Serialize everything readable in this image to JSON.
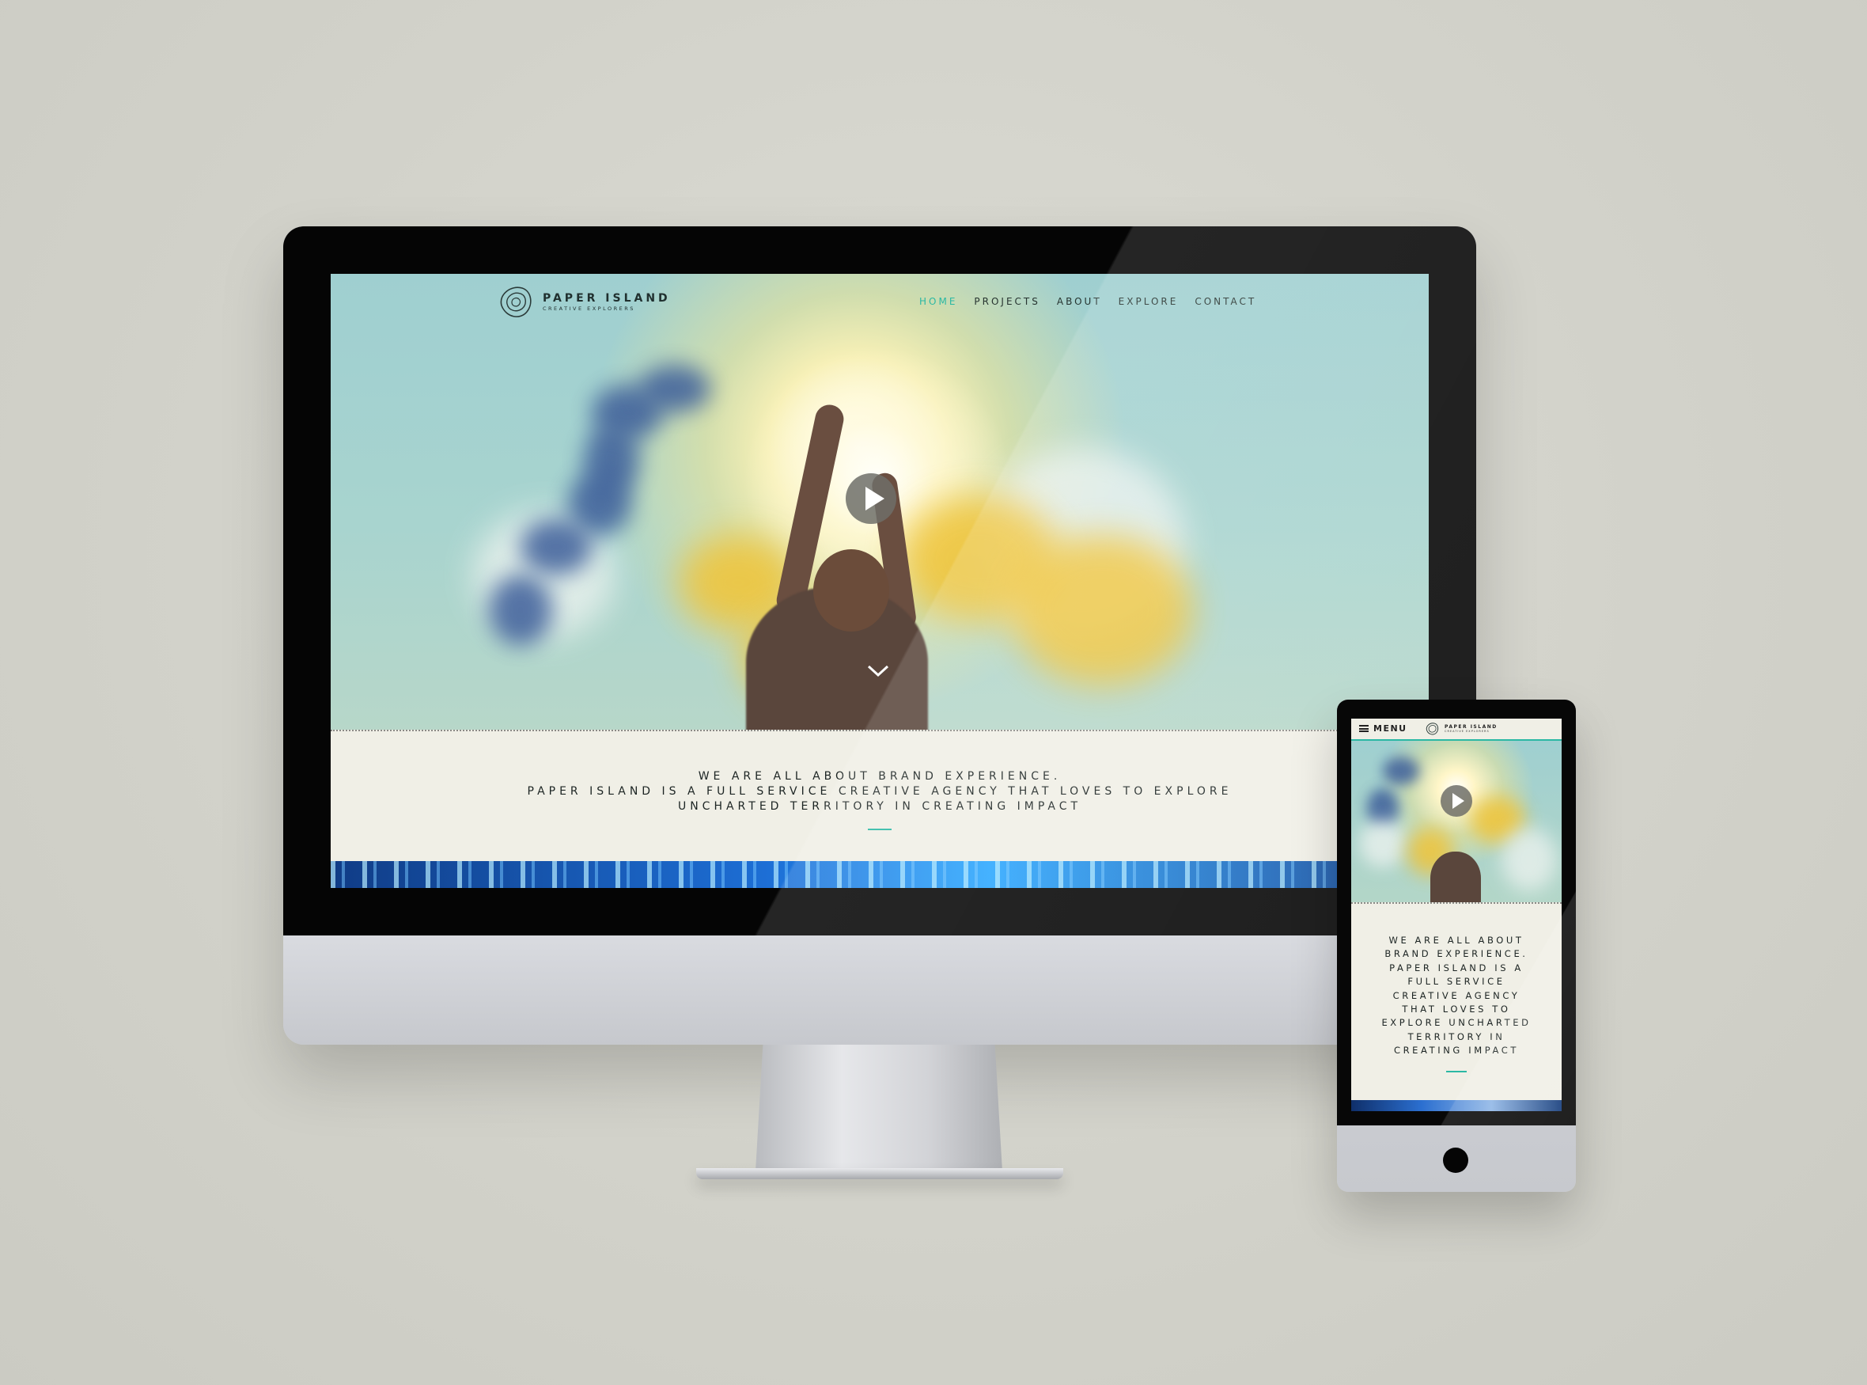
{
  "desktop": {
    "logo": {
      "title": "PAPER ISLAND",
      "subtitle": "CREATIVE EXPLORERS"
    },
    "nav": [
      {
        "label": "HOME",
        "active": true
      },
      {
        "label": "PROJECTS",
        "active": false
      },
      {
        "label": "ABOUT",
        "active": false
      },
      {
        "label": "EXPLORE",
        "active": false
      },
      {
        "label": "CONTACT",
        "active": false
      }
    ],
    "intro": {
      "line1": "WE ARE ALL ABOUT BRAND EXPERIENCE.",
      "line2": "PAPER ISLAND IS A FULL SERVICE CREATIVE AGENCY THAT LOVES TO EXPLORE UNCHARTED TERRITORY IN CREATING IMPACT"
    }
  },
  "mobile": {
    "menu_label": "MENU",
    "logo": {
      "title": "PAPER ISLAND",
      "subtitle": "CREATIVE EXPLORERS"
    },
    "intro": "WE ARE ALL ABOUT BRAND EXPERIENCE. PAPER ISLAND IS A FULL SERVICE CREATIVE AGENCY THAT LOVES TO EXPLORE UNCHARTED TERRITORY IN CREATING IMPACT"
  },
  "colors": {
    "accent": "#2bb8a4",
    "text": "#1c2423",
    "panel": "#f0efe6",
    "backdrop": "#d3d3cb"
  },
  "icons": {
    "logo": "island-contour-icon",
    "play": "play-icon",
    "scroll": "chevron-down-icon",
    "menu": "hamburger-icon"
  }
}
